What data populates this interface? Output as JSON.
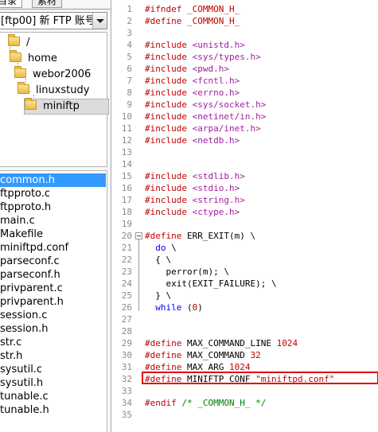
{
  "tabs": [
    "目录",
    "素材"
  ],
  "site_combo": {
    "value": "[ftp00] 新 FTP 账号"
  },
  "tree": [
    "/",
    "home",
    "webor2006",
    "linuxstudy",
    "miniftp"
  ],
  "files": {
    "selected": "common.h",
    "items": [
      "common.h",
      "ftpproto.c",
      "ftpproto.h",
      "main.c",
      "Makefile",
      "miniftpd.conf",
      "parseconf.c",
      "parseconf.h",
      "privparent.c",
      "privparent.h",
      "session.c",
      "session.h",
      "str.c",
      "str.h",
      "sysutil.c",
      "sysutil.h",
      "tunable.c",
      "tunable.h"
    ]
  },
  "editor": {
    "line_numbers": [
      "1",
      "2",
      "3",
      "4",
      "5",
      "6",
      "7",
      "8",
      "9",
      "10",
      "11",
      "12",
      "13",
      "14",
      "15",
      "16",
      "17",
      "18",
      "19",
      "20",
      "21",
      "22",
      "23",
      "24",
      "25",
      "26",
      "27",
      "28",
      "29",
      "30",
      "31",
      "32",
      "33",
      "34",
      "35"
    ],
    "line_1": [
      "#ifndef",
      " _COMMON_H_"
    ],
    "line_2": [
      "#define",
      " _COMMON_H_"
    ],
    "line_4": [
      "#include",
      " <unistd.h>"
    ],
    "line_5": [
      "#include",
      " <sys/types.h>"
    ],
    "line_6": [
      "#include",
      " <pwd.h>"
    ],
    "line_7": [
      "#include",
      " <fcntl.h>"
    ],
    "line_8": [
      "#include",
      " <errno.h>"
    ],
    "line_9": [
      "#include",
      " <sys/socket.h>"
    ],
    "line_10": [
      "#include",
      " <netinet/in.h>"
    ],
    "line_11": [
      "#include",
      " <arpa/inet.h>"
    ],
    "line_12": [
      "#include",
      " <netdb.h>"
    ],
    "line_15": [
      "#include",
      " <stdlib.h>"
    ],
    "line_16": [
      "#include",
      " <stdio.h>"
    ],
    "line_17": [
      "#include",
      " <string.h>"
    ],
    "line_18": [
      "#include",
      " <ctype.h>"
    ],
    "line_20": [
      "#define",
      " ERR_EXIT(m) \\"
    ],
    "line_21": [
      "  ",
      "do",
      " \\"
    ],
    "line_22": "  { \\",
    "line_23": "    perror(m); \\",
    "line_24": "    exit(EXIT_FAILURE); \\",
    "line_25": "  } \\",
    "line_26": [
      "  ",
      "while",
      " (",
      "0",
      ")"
    ],
    "line_29": [
      "#define",
      " MAX_COMMAND_LINE ",
      "1024"
    ],
    "line_30": [
      "#define",
      " MAX_COMMAND ",
      "32"
    ],
    "line_31": [
      "#define",
      " MAX_ARG ",
      "1024"
    ],
    "line_32": [
      "#define",
      " MINIFTP_CONF ",
      "\"miniftpd.conf\""
    ],
    "line_34": [
      "#endif",
      " ",
      "/* _COMMON_H_ */"
    ]
  },
  "colors": {
    "selection": "#3399ff",
    "preprocessor": "#a020a0",
    "literal": "#c00000",
    "comment": "#008000",
    "keyword": "#0000ff",
    "highlight_box": "#e00000"
  }
}
